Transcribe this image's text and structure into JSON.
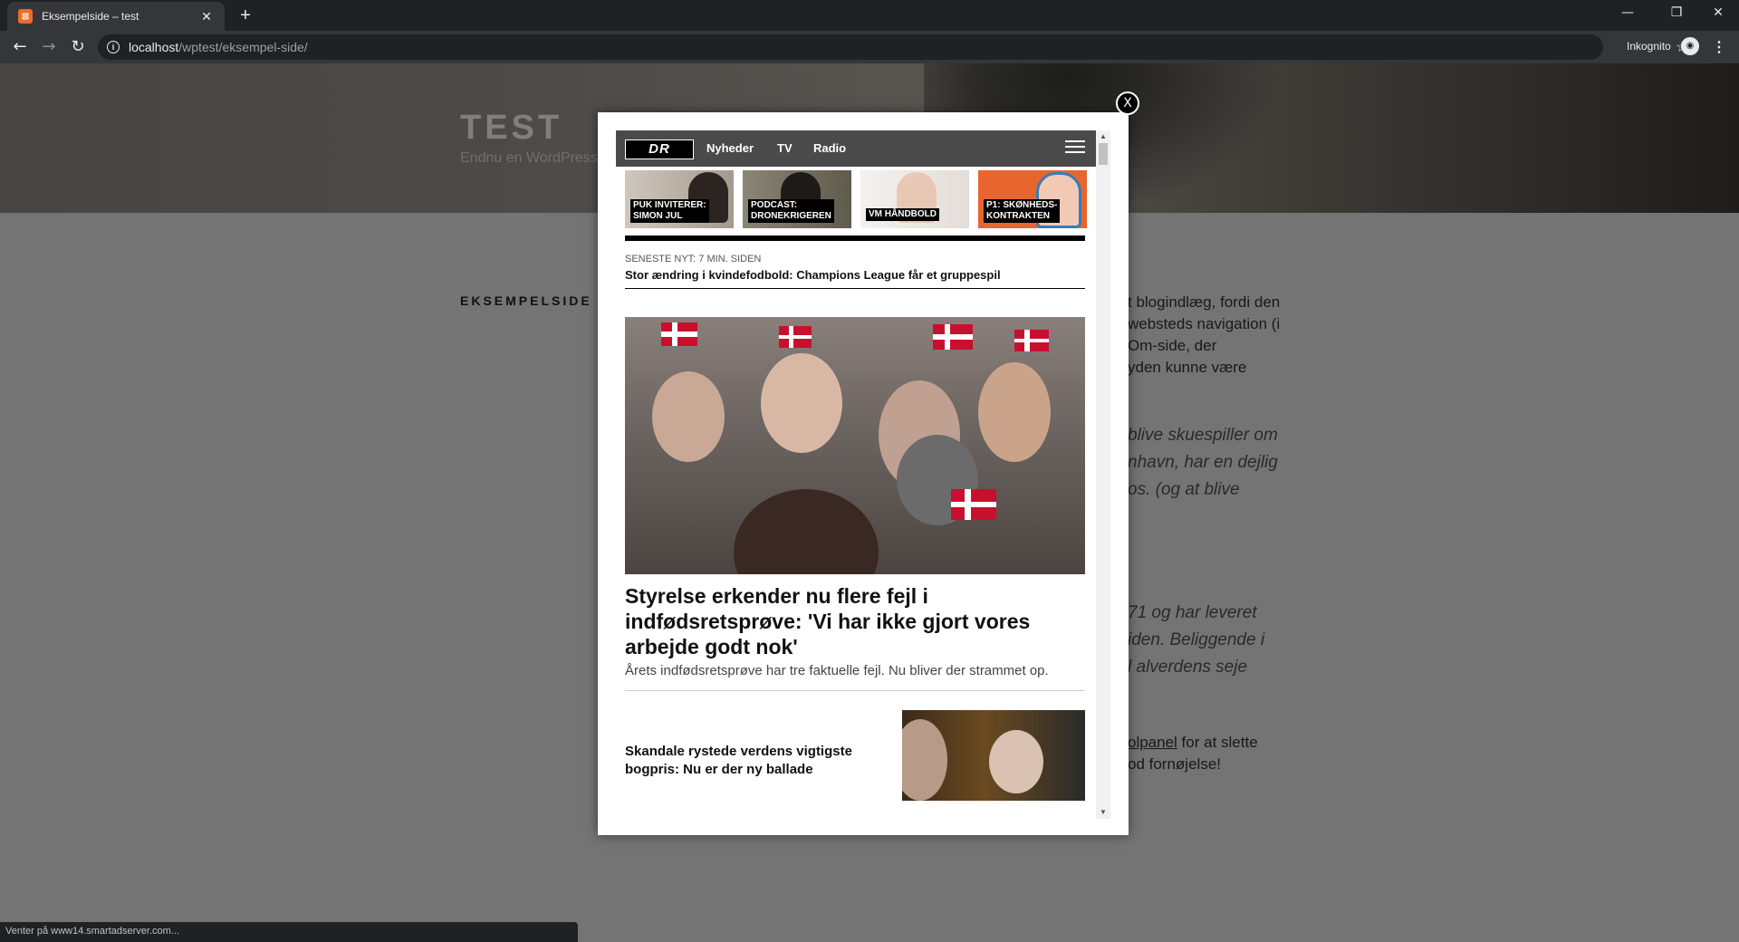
{
  "browser": {
    "tab_title": "Eksempelside – test",
    "tab_close": "✕",
    "new_tab": "+",
    "url_host": "localhost",
    "url_path": "/wptest/eksempel-side/",
    "incognito_label": "Inkognito",
    "window_controls": [
      "—",
      "❐",
      "✕"
    ],
    "status_text": "Venter på www14.smartadserver.com..."
  },
  "site": {
    "title": "TEST",
    "description": "Endnu en WordPress",
    "page_heading": "EKSEMPELSIDE",
    "body_lines": [
      "t blogindlæg, fordi den",
      "websteds navigation (i",
      "Om-side, der",
      "yden kunne være"
    ],
    "quote1_lines": [
      "blive skuespiller om",
      "nhavn, har en dejlig",
      "os. (og at blive"
    ],
    "quote2_lines": [
      "71 og har leveret",
      "iden. Beliggende i",
      "l alverdens seje"
    ],
    "final_link": "olpanel",
    "final_line1_rest": " for at slette",
    "final_line2": "od fornøjelse!"
  },
  "popup": {
    "close_label": "X",
    "dr": {
      "logo": "DR",
      "nav": [
        "Nyheder",
        "TV",
        "Radio"
      ],
      "tiles": [
        {
          "label1": "PUK INVITERER:",
          "label2": "SIMON JUL"
        },
        {
          "label1": "PODCAST:",
          "label2": "DRONEKRIGEREN"
        },
        {
          "label1": "VM HÅNDBOLD",
          "label2": ""
        },
        {
          "label1": "P1: SKØNHEDS-",
          "label2": "KONTRAKTEN"
        }
      ],
      "latest_meta": "SENESTE NYT: 7 MIN. SIDEN",
      "latest_headline": "Stor ændring i kvindefodbold: Champions League får et gruppespil",
      "main_headline": "Styrelse erkender nu flere fejl i indfødsretsprøve: 'Vi har ikke gjort vores arbejde godt nok'",
      "main_sub": "Årets indfødsretsprøve har tre faktuelle fejl. Nu bliver der strammet op.",
      "story2_title": "Skandale rystede verdens vigtigste bogpris: Nu er der ny ballade"
    }
  },
  "colors": {
    "chrome_dark": "#202124",
    "chrome_mid": "#35363a",
    "dr_header": "#4a4a4a",
    "danish_red": "#c8102e"
  }
}
